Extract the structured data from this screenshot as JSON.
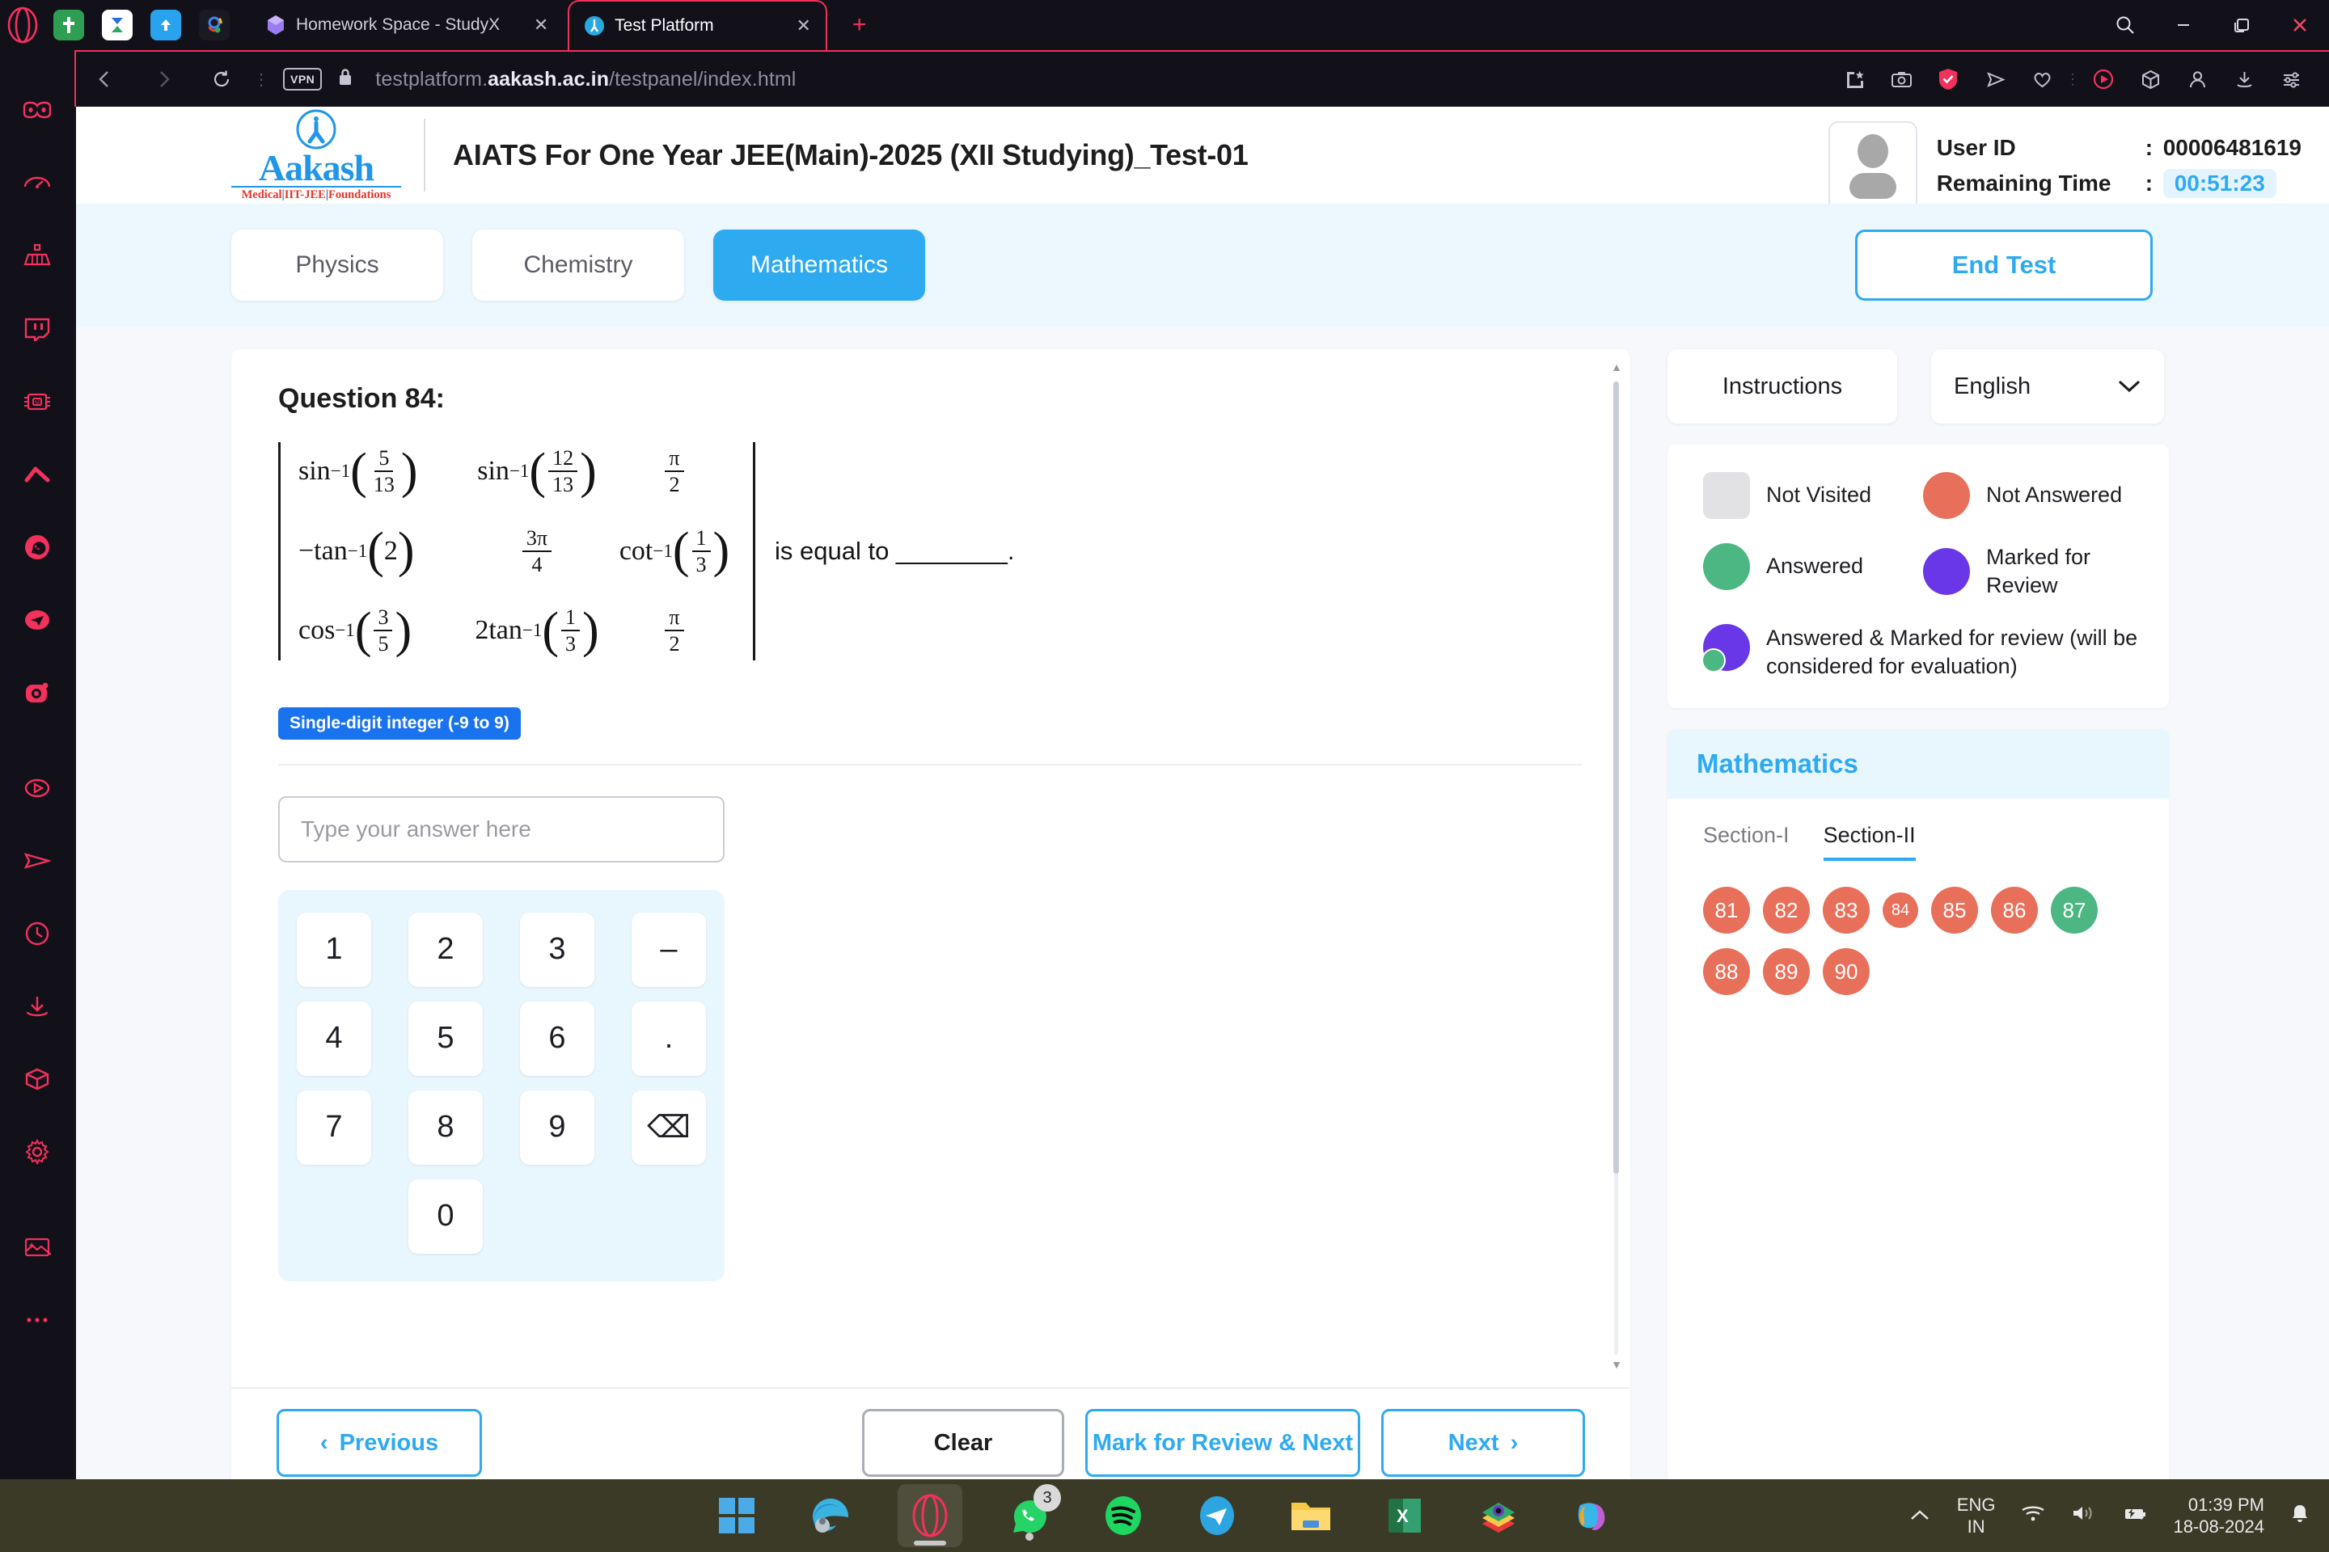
{
  "browser": {
    "tabs": [
      {
        "title": "Homework Space - StudyX",
        "active": false
      },
      {
        "title": "Test Platform",
        "active": true
      }
    ],
    "new_tab_label": "+",
    "close_label": "✕",
    "address": {
      "vpn_badge": "VPN",
      "url_prefix": "testplatform.",
      "url_domain": "aakash.ac.in",
      "url_path": "/testpanel/index.html"
    },
    "window_controls": {
      "search": "⌕",
      "minimize": "—",
      "maximize": "❐",
      "close": "✕"
    }
  },
  "header": {
    "logo_word": "Aakash",
    "logo_sub_left": "Medical",
    "logo_sub_mid": "IIT-JEE",
    "logo_sub_right": "Foundations",
    "exam_title": "AIATS For One Year JEE(Main)-2025 (XII Studying)_Test-01",
    "user_id_label": "User ID",
    "user_id_value": "00006481619",
    "remaining_label": "Remaining Time",
    "remaining_value": "00:51:23",
    "colon": ":"
  },
  "subjects": {
    "items": [
      {
        "label": "Physics",
        "active": false
      },
      {
        "label": "Chemistry",
        "active": false
      },
      {
        "label": "Mathematics",
        "active": true
      }
    ],
    "end_test": "End Test"
  },
  "question": {
    "title": "Question 84:",
    "matrix": [
      [
        {
          "fn": "sin",
          "sup": "-1",
          "num": "5",
          "den": "13",
          "type": "invfrac"
        },
        {
          "fn": "sin",
          "sup": "-1",
          "num": "12",
          "den": "13",
          "type": "invfrac"
        },
        {
          "num": "π",
          "den": "2",
          "type": "frac"
        }
      ],
      [
        {
          "fn": "−tan",
          "sup": "-1",
          "arg": "2",
          "type": "invarg"
        },
        {
          "num": "3π",
          "den": "4",
          "type": "frac"
        },
        {
          "fn": "cot",
          "sup": "-1",
          "num": "1",
          "den": "3",
          "type": "invfrac"
        }
      ],
      [
        {
          "fn": "cos",
          "sup": "-1",
          "num": "3",
          "den": "5",
          "type": "invfrac"
        },
        {
          "fn": "2tan",
          "sup": "-1",
          "num": "1",
          "den": "3",
          "type": "invfrac"
        },
        {
          "num": "π",
          "den": "2",
          "type": "frac"
        }
      ]
    ],
    "equals_text": "is equal to ________.",
    "answer_type_badge": "Single-digit integer (-9 to 9)",
    "answer_placeholder": "Type your answer here",
    "answer_value": "",
    "keypad": [
      "1",
      "2",
      "3",
      "–",
      "4",
      "5",
      "6",
      ".",
      "7",
      "8",
      "9",
      "⌫",
      "0"
    ]
  },
  "footer": {
    "previous": "Previous",
    "clear": "Clear",
    "mark_review_next": "Mark for Review & Next",
    "next": "Next",
    "prev_arrow": "‹",
    "next_arrow": "›"
  },
  "rightpanel": {
    "instructions": "Instructions",
    "language": "English",
    "chevron": "⌄",
    "legend": [
      {
        "label": "Not Visited",
        "kind": "square",
        "color": "#e2e2e4"
      },
      {
        "label": "Not Answered",
        "kind": "circle",
        "color": "#e8705a"
      },
      {
        "label": "Answered",
        "kind": "circle",
        "color": "#4cb782"
      },
      {
        "label": "Marked for Review",
        "kind": "circle",
        "color": "#6937e8"
      },
      {
        "label": "Answered & Marked for review (will be considered for evaluation)",
        "kind": "circle-badge",
        "color": "#6937e8"
      }
    ],
    "palette_title": "Mathematics",
    "sections": [
      {
        "label": "Section-I",
        "active": false
      },
      {
        "label": "Section-II",
        "active": true
      }
    ],
    "questions": [
      {
        "n": "81",
        "state": "red"
      },
      {
        "n": "82",
        "state": "red"
      },
      {
        "n": "83",
        "state": "red"
      },
      {
        "n": "84",
        "state": "red",
        "current": true
      },
      {
        "n": "85",
        "state": "red"
      },
      {
        "n": "86",
        "state": "red"
      },
      {
        "n": "87",
        "state": "green"
      },
      {
        "n": "88",
        "state": "red"
      },
      {
        "n": "89",
        "state": "red"
      },
      {
        "n": "90",
        "state": "red"
      }
    ]
  },
  "taskbar": {
    "apps": [
      "start",
      "edge",
      "opera",
      "whatsapp",
      "spotify",
      "telegram",
      "file-explorer",
      "excel",
      "photo-app",
      "copilot"
    ],
    "whatsapp_badge": "3",
    "tray": {
      "chevron": "⌃",
      "lang_line1": "ENG",
      "lang_line2": "IN",
      "time": "01:39 PM",
      "date": "18-08-2024"
    }
  },
  "colors": {
    "accent": "#2eaaf0",
    "opera_red": "#f2315c",
    "badge_blue": "#1a73ee",
    "green": "#4cb782",
    "red": "#e8705a",
    "purple": "#6937e8"
  }
}
